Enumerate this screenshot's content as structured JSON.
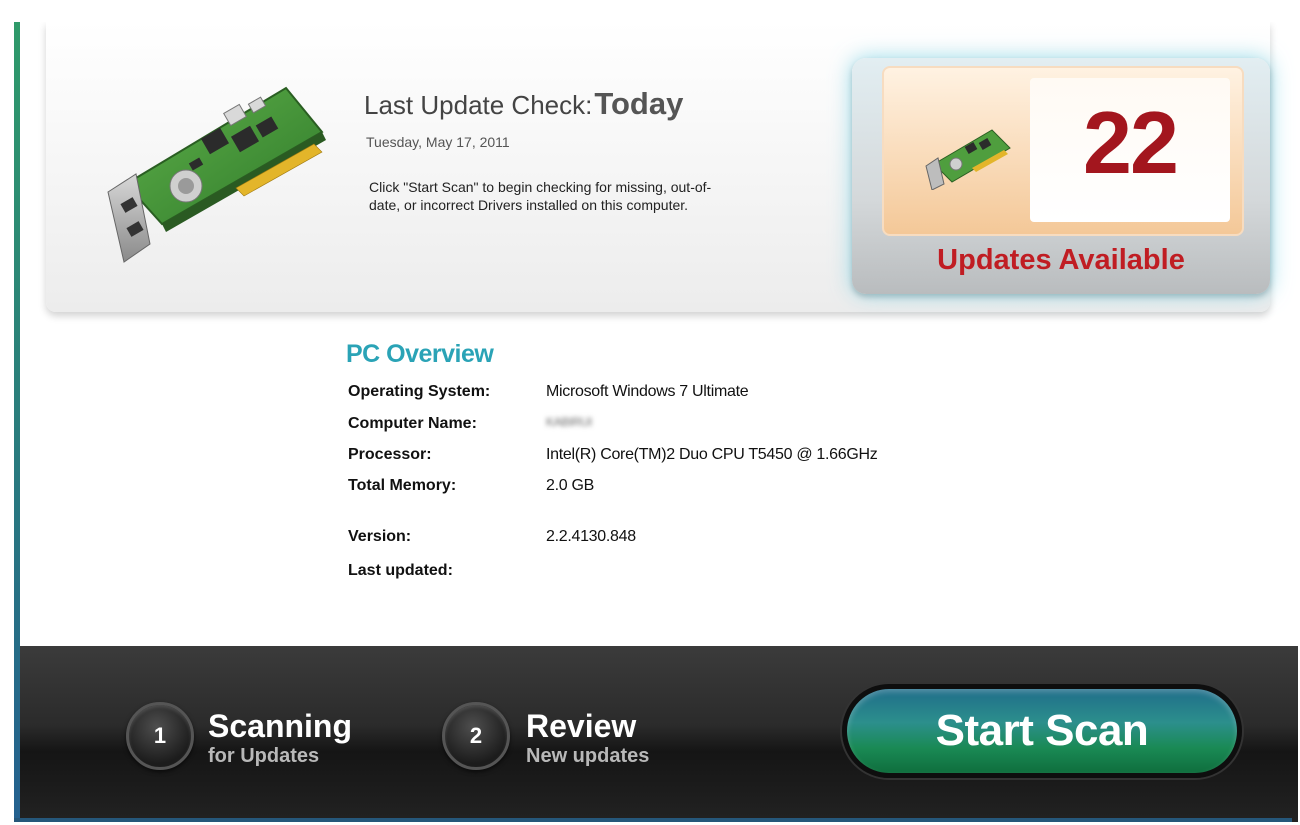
{
  "header": {
    "last_check_label": "Last Update Check:",
    "last_check_value": "Today",
    "date": "Tuesday, May 17, 2011",
    "instructions": "Click \"Start Scan\" to begin checking for missing, out-of-date, or incorrect Drivers installed on this computer."
  },
  "updates": {
    "count": "22",
    "caption": "Updates Available"
  },
  "overview": {
    "title": "PC Overview",
    "rows": [
      {
        "label": "Operating System:",
        "value": "Microsoft Windows 7 Ultimate"
      },
      {
        "label": "Computer Name:",
        "value": "KABIRUI"
      },
      {
        "label": "Processor:",
        "value": "Intel(R) Core(TM)2 Duo CPU T5450 @ 1.66GHz"
      },
      {
        "label": "Total Memory:",
        "value": "2.0 GB"
      },
      {
        "label": "Version:",
        "value": "2.2.4130.848"
      },
      {
        "label": "Last updated:",
        "value": ""
      }
    ]
  },
  "steps": [
    {
      "number": "1",
      "title": "Scanning",
      "subtitle": "for Updates"
    },
    {
      "number": "2",
      "title": "Review",
      "subtitle": "New updates"
    }
  ],
  "start_button": "Start Scan",
  "colors": {
    "accent_teal": "#2aa3b6",
    "alert_red": "#c01d23",
    "button_green": "#1a8a55"
  },
  "icons": {
    "hardware": "network-card-icon"
  }
}
